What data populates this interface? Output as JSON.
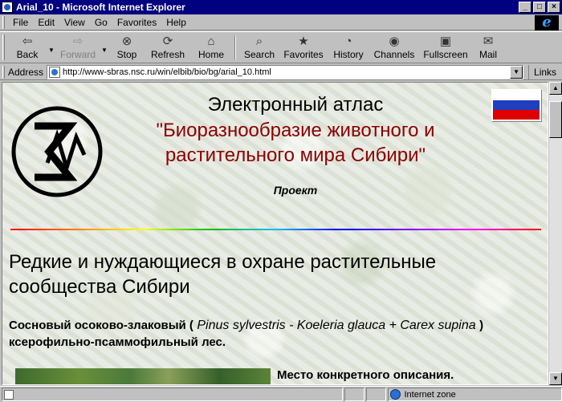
{
  "window": {
    "title": "Arial_10 - Microsoft Internet Explorer",
    "controls": {
      "minimize": "_",
      "maximize": "□",
      "close": "×"
    }
  },
  "menu": {
    "items": [
      {
        "label": "File",
        "accel": "F"
      },
      {
        "label": "Edit",
        "accel": "E"
      },
      {
        "label": "View",
        "accel": "V"
      },
      {
        "label": "Go",
        "accel": "G"
      },
      {
        "label": "Favorites",
        "accel": "a"
      },
      {
        "label": "Help",
        "accel": "H"
      }
    ],
    "logo": "e"
  },
  "toolbar": {
    "back": "Back",
    "forward": "Forward",
    "stop": "Stop",
    "refresh": "Refresh",
    "home": "Home",
    "search": "Search",
    "favorites": "Favorites",
    "history": "History",
    "channels": "Channels",
    "fullscreen": "Fullscreen",
    "mail": "Mail"
  },
  "address": {
    "label": "Address",
    "url": "http://www-sbras.nsc.ru/win/elbib/bio/bg/arial_10.html",
    "links": "Links"
  },
  "page": {
    "heading_atlas": "Электронный атлас",
    "heading_bio": "\"Биоразнообразие животного и растительного мира Сибири\"",
    "project": "Проект",
    "section_title": "Редкие и нуждающиеся в охране растительные сообщества Сибири",
    "desc_prefix": "Сосновый осоково-злаковый (",
    "desc_latin": " Pinus sylvestris - Koeleria glauca + Carex supina ",
    "desc_suffix": ") ксерофильно-псаммофильный лес.",
    "place": "Место конкретного описания.",
    "flag_colors": [
      "#ffffff",
      "#1f3fbf",
      "#e00000"
    ]
  },
  "status": {
    "zone": "Internet zone"
  }
}
